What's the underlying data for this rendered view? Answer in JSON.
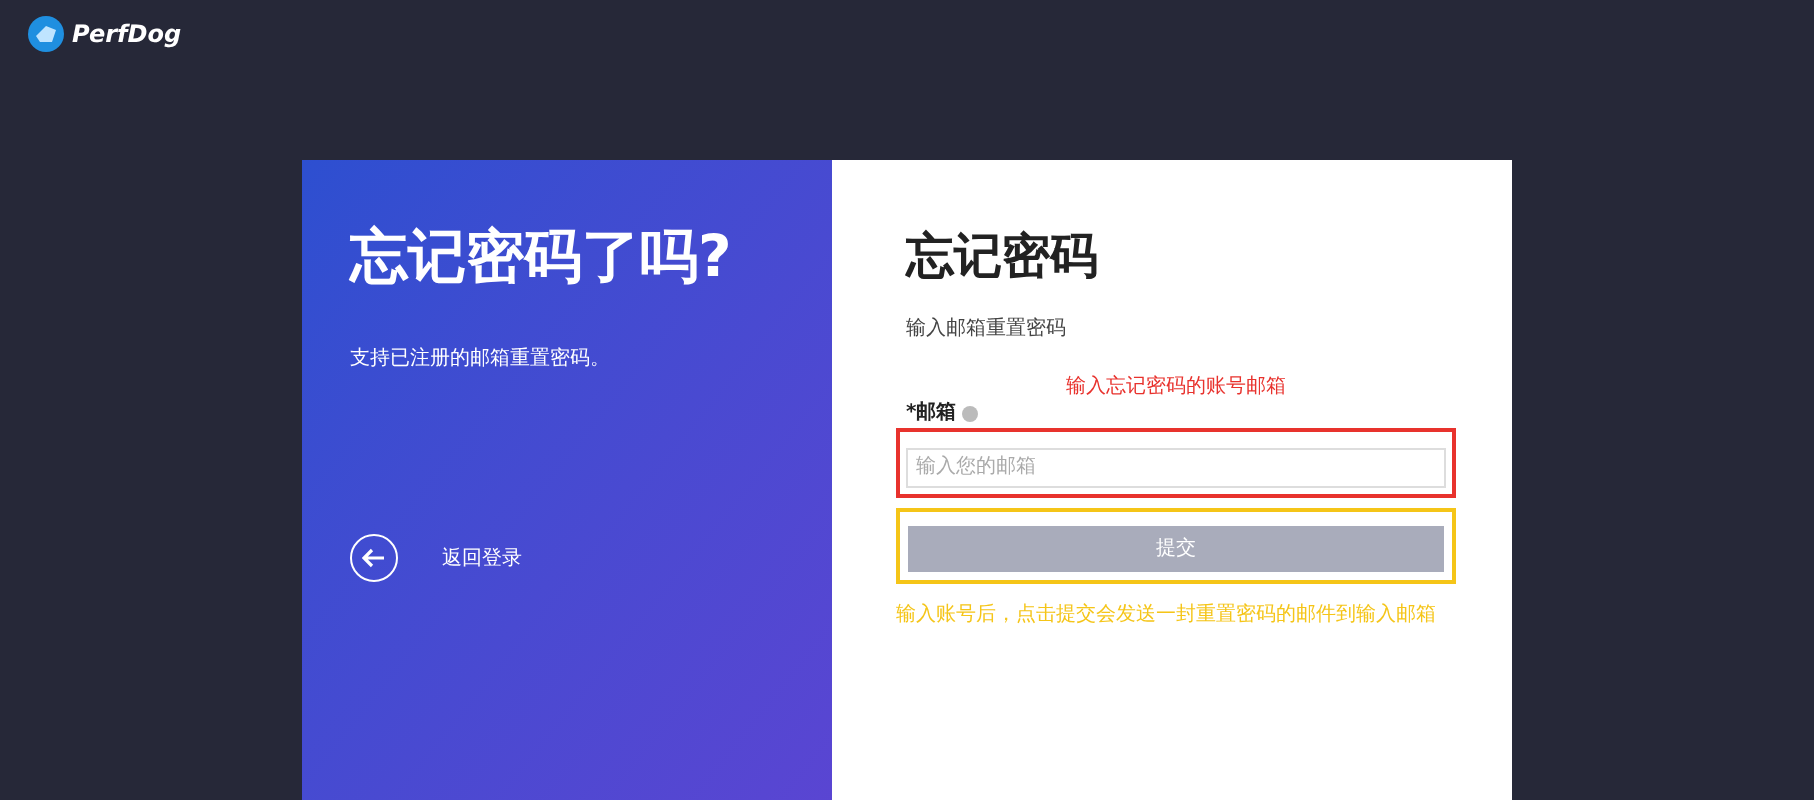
{
  "brand": {
    "name": "PerfDog"
  },
  "left_panel": {
    "title": "忘记密码了吗?",
    "subtitle": "支持已注册的邮箱重置密码。",
    "back_link": "返回登录"
  },
  "form": {
    "title": "忘记密码",
    "subtitle": "输入邮箱重置密码",
    "email_label": "*邮箱",
    "email_placeholder": "输入您的邮箱",
    "submit": {
      "label": "提交",
      "disabled": true
    }
  },
  "annotations": [
    {
      "text": "输入忘记密码的账号邮箱",
      "color": "#e8322d"
    },
    {
      "text": "输入账号后，点击提交会发送一封重置密码的邮件到输入邮箱",
      "color": "#f5c518"
    }
  ]
}
